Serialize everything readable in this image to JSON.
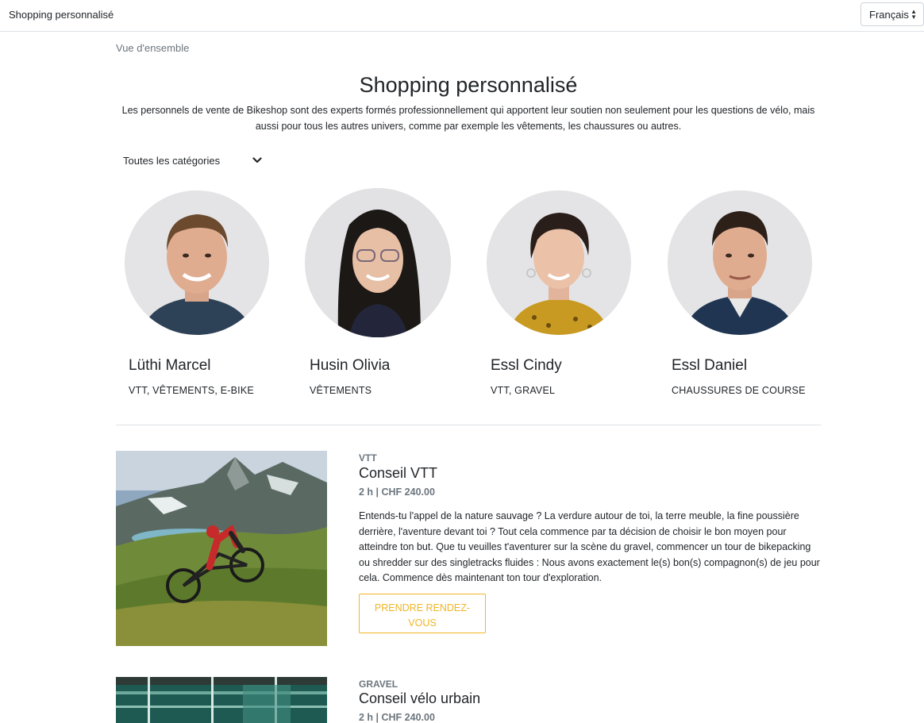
{
  "header": {
    "brand": "Shopping personnalisé",
    "language": "Français"
  },
  "breadcrumb": "Vue d'ensemble",
  "page": {
    "title": "Shopping personnalisé",
    "intro_line1": "Les personnels de vente de Bikeshop sont des experts formés professionnellement qui apportent leur soutien non seulement pour les questions de vélo, mais",
    "intro_line2": "aussi pour tous les autres univers, comme par exemple les vêtements, les chaussures ou autres."
  },
  "filter": {
    "category": "Toutes les catégories"
  },
  "staff": [
    {
      "name": "Lüthi Marcel",
      "categories": "VTT, VÊTEMENTS, E-BIKE"
    },
    {
      "name": "Husin Olivia",
      "categories": "VÊTEMENTS"
    },
    {
      "name": "Essl Cindy",
      "categories": "VTT, GRAVEL"
    },
    {
      "name": "Essl Daniel",
      "categories": "CHAUSSURES DE COURSE"
    }
  ],
  "services": [
    {
      "category": "VTT",
      "title": "Conseil VTT",
      "meta": "2 h | CHF 240.00",
      "description": "Entends-tu l'appel de la nature sauvage ? La verdure autour de toi, la terre meuble, la fine poussière derrière, l'aventure devant toi ? Tout cela commence par ta décision de choisir le bon moyen pour atteindre ton but. Que tu veuilles t'aventurer sur la scène du gravel, commencer un tour de bikepacking ou shredder sur des singletracks fluides : Nous avons exactement le(s) bon(s) compagnon(s) de jeu pour cela. Commence dès maintenant ton tour d'exploration.",
      "button_line1": "PRENDRE RENDEZ-",
      "button_line2": "VOUS"
    },
    {
      "category": "GRAVEL",
      "title": "Conseil vélo urbain",
      "meta": "2 h | CHF 240.00"
    }
  ],
  "colors": {
    "accent": "#f0b625",
    "muted": "#6c757d",
    "border": "#dee2e6"
  }
}
